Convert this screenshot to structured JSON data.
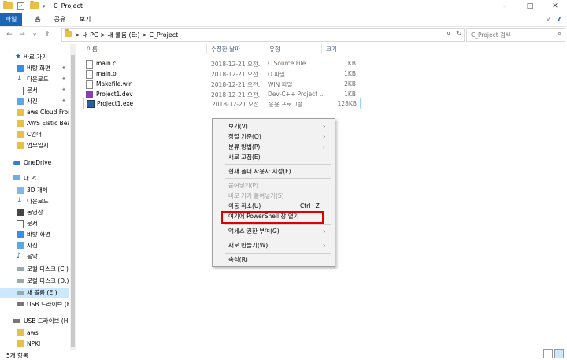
{
  "window": {
    "title": "C_Project",
    "controls": {
      "minimize": "–",
      "maximize": "□",
      "close": "✕"
    }
  },
  "ribbon": {
    "tabs": [
      "파일",
      "홈",
      "공유",
      "보기"
    ]
  },
  "address": {
    "segments": [
      "내 PC",
      "새 볼륨 (E:)",
      "C_Project"
    ],
    "separator": ">",
    "search_placeholder": "C_Project 검색"
  },
  "sidebar": {
    "quick_access_label": "바로 가기",
    "quick_access": [
      "바탕 화면",
      "다운로드",
      "문서",
      "사진",
      "aws Cloud Front",
      "AWS Elstic Bean",
      "C언어",
      "업무일지"
    ],
    "onedrive_label": "OneDrive",
    "pc_label": "내 PC",
    "pc_items": [
      "3D 개체",
      "다운로드",
      "동영상",
      "문서",
      "바탕 화면",
      "사진",
      "음악",
      "로컬 디스크 (C:)",
      "로컬 디스크 (D:)",
      "새 볼륨 (E:)",
      "USB 드라이브 (H:)"
    ],
    "usb_label": "USB 드라이브 (H:)",
    "usb_items": [
      "aws",
      "NPKI"
    ]
  },
  "columns": {
    "name": "이름",
    "date": "수정한 날짜",
    "type": "유형",
    "size": "크기"
  },
  "files": [
    {
      "name": "main.c",
      "date": "2018-12-21 오전...",
      "type": "C Source File",
      "size": "1KB"
    },
    {
      "name": "main.o",
      "date": "2018-12-21 오전...",
      "type": "O 파일",
      "size": "1KB"
    },
    {
      "name": "Makefile.win",
      "date": "2018-12-21 오전...",
      "type": "WIN 파일",
      "size": "2KB"
    },
    {
      "name": "Project1.dev",
      "date": "2018-12-21 오전...",
      "type": "Dev-C++ Project ...",
      "size": "1KB"
    },
    {
      "name": "Project1.exe",
      "date": "2018-12-21 오전...",
      "type": "응용 프로그램",
      "size": "128KB"
    }
  ],
  "context_menu": {
    "items": [
      {
        "label": "보기(V)",
        "submenu": true,
        "disabled": false
      },
      {
        "label": "정렬 기준(O)",
        "submenu": true,
        "disabled": false
      },
      {
        "label": "분류 방법(P)",
        "submenu": true,
        "disabled": false
      },
      {
        "label": "새로 고침(E)",
        "submenu": false,
        "disabled": false
      },
      {
        "label": "현재 폴더 사용자 지정(F)...",
        "submenu": false,
        "disabled": false
      },
      {
        "label": "붙여넣기(P)",
        "submenu": false,
        "disabled": true
      },
      {
        "label": "바로 가기 붙여넣기(S)",
        "submenu": false,
        "disabled": true
      },
      {
        "label": "이동 취소(U)",
        "shortcut": "Ctrl+Z",
        "submenu": false,
        "disabled": false
      },
      {
        "label": "여기에 PowerShell 창 열기",
        "submenu": false,
        "disabled": false
      },
      {
        "label": "액세스 권한 부여(G)",
        "submenu": true,
        "disabled": false
      },
      {
        "label": "새로 만들기(W)",
        "submenu": true,
        "disabled": false
      },
      {
        "label": "속성(R)",
        "submenu": false,
        "disabled": false
      }
    ],
    "submenu_arrow": "›",
    "highlight_color": "#e00000"
  },
  "status": {
    "item_count": "5개 항목"
  },
  "colors": {
    "accent": "#1a65b5",
    "selection": "#cce8ff",
    "selected_border": "#99d1ff"
  }
}
